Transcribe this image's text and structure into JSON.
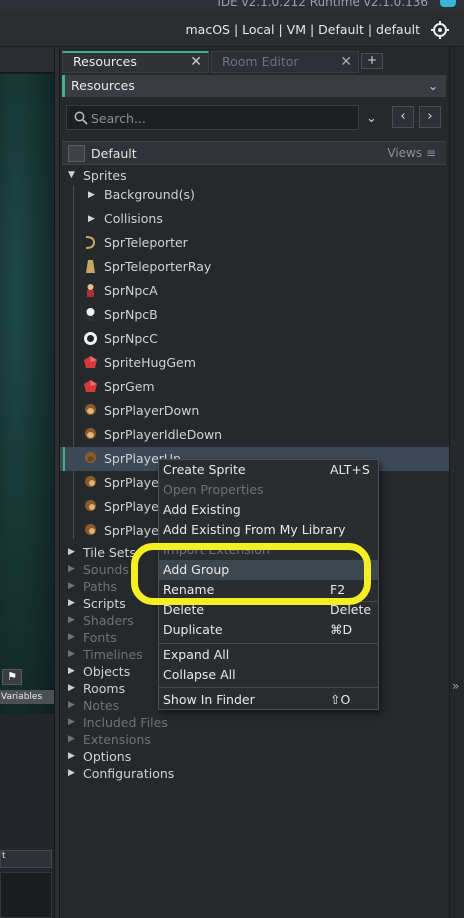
{
  "title_bar": {
    "version_text": "IDE v2.1.0.212 Runtime v2.1.0.136"
  },
  "target_bar": {
    "target": "macOS | Local | VM | Default | default"
  },
  "left_pane": {
    "variables_label": "Variables",
    "bottom_box_label": "t"
  },
  "tabs": [
    {
      "label": "Resources",
      "active": true
    },
    {
      "label": "Room Editor",
      "active": false
    }
  ],
  "add_tab_label": "+",
  "resources_dropdown": {
    "value": "Resources"
  },
  "search": {
    "placeholder": "Search...",
    "value": ""
  },
  "group": {
    "name": "Default",
    "views_label": "Views"
  },
  "tree": {
    "sprites": {
      "label": "Sprites",
      "subfolders": [
        "Background(s)",
        "Collisions"
      ],
      "items": [
        {
          "label": "SprTeleporter",
          "icon": "teleporter-icon"
        },
        {
          "label": "SprTeleporterRay",
          "icon": "ray-icon"
        },
        {
          "label": "SprNpcA",
          "icon": "npc-a-icon"
        },
        {
          "label": "SprNpcB",
          "icon": "npc-b-icon"
        },
        {
          "label": "SprNpcC",
          "icon": "npc-c-icon"
        },
        {
          "label": "SpriteHugGem",
          "icon": "gem-icon"
        },
        {
          "label": "SprGem",
          "icon": "gem-icon"
        },
        {
          "label": "SprPlayerDown",
          "icon": "monkey-icon"
        },
        {
          "label": "SprPlayerIdleDown",
          "icon": "monkey-icon"
        },
        {
          "label": "SprPlayerUp",
          "icon": "monkey-icon"
        },
        {
          "label": "SprPlayer",
          "icon": "monkey-icon"
        },
        {
          "label": "SprPlayer",
          "icon": "monkey-icon"
        },
        {
          "label": "SprPlayer",
          "icon": "monkey-icon"
        }
      ]
    },
    "folders": [
      {
        "label": "Tile Sets",
        "has_children": true
      },
      {
        "label": "Sounds",
        "has_children": false
      },
      {
        "label": "Paths",
        "has_children": false
      },
      {
        "label": "Scripts",
        "has_children": true
      },
      {
        "label": "Shaders",
        "has_children": false
      },
      {
        "label": "Fonts",
        "has_children": false
      },
      {
        "label": "Timelines",
        "has_children": false
      },
      {
        "label": "Objects",
        "has_children": true
      },
      {
        "label": "Rooms",
        "has_children": true
      },
      {
        "label": "Notes",
        "has_children": false
      },
      {
        "label": "Included Files",
        "has_children": false
      },
      {
        "label": "Extensions",
        "has_children": false
      },
      {
        "label": "Options",
        "has_children": true
      },
      {
        "label": "Configurations",
        "has_children": true
      }
    ]
  },
  "context_menu": {
    "items": [
      {
        "label": "Create Sprite",
        "shortcut": "ALT+S",
        "enabled": true
      },
      {
        "label": "Open Properties",
        "shortcut": "",
        "enabled": false
      },
      {
        "label": "Add Existing",
        "shortcut": "",
        "enabled": true
      },
      {
        "label": "Add Existing From My Library",
        "shortcut": "",
        "enabled": true
      },
      {
        "label": "Import Extension",
        "shortcut": "",
        "enabled": false
      },
      {
        "label": "Add Group",
        "shortcut": "",
        "enabled": true,
        "highlighted": true
      },
      {
        "label": "Rename",
        "shortcut": "F2",
        "enabled": true
      },
      {
        "label": "Delete",
        "shortcut": "Delete",
        "enabled": true
      },
      {
        "label": "Duplicate",
        "shortcut": "⌘D",
        "enabled": true
      },
      {
        "label": "Expand All",
        "shortcut": "",
        "enabled": true
      },
      {
        "label": "Collapse All",
        "shortcut": "",
        "enabled": true
      },
      {
        "label": "Show In Finder",
        "shortcut": "⇧O",
        "enabled": true
      }
    ]
  },
  "colors": {
    "accent": "#3fb28a",
    "highlight_ring": "#f4ee24",
    "menu_bg": "#2a2d30",
    "panel_bg": "#26292c"
  }
}
